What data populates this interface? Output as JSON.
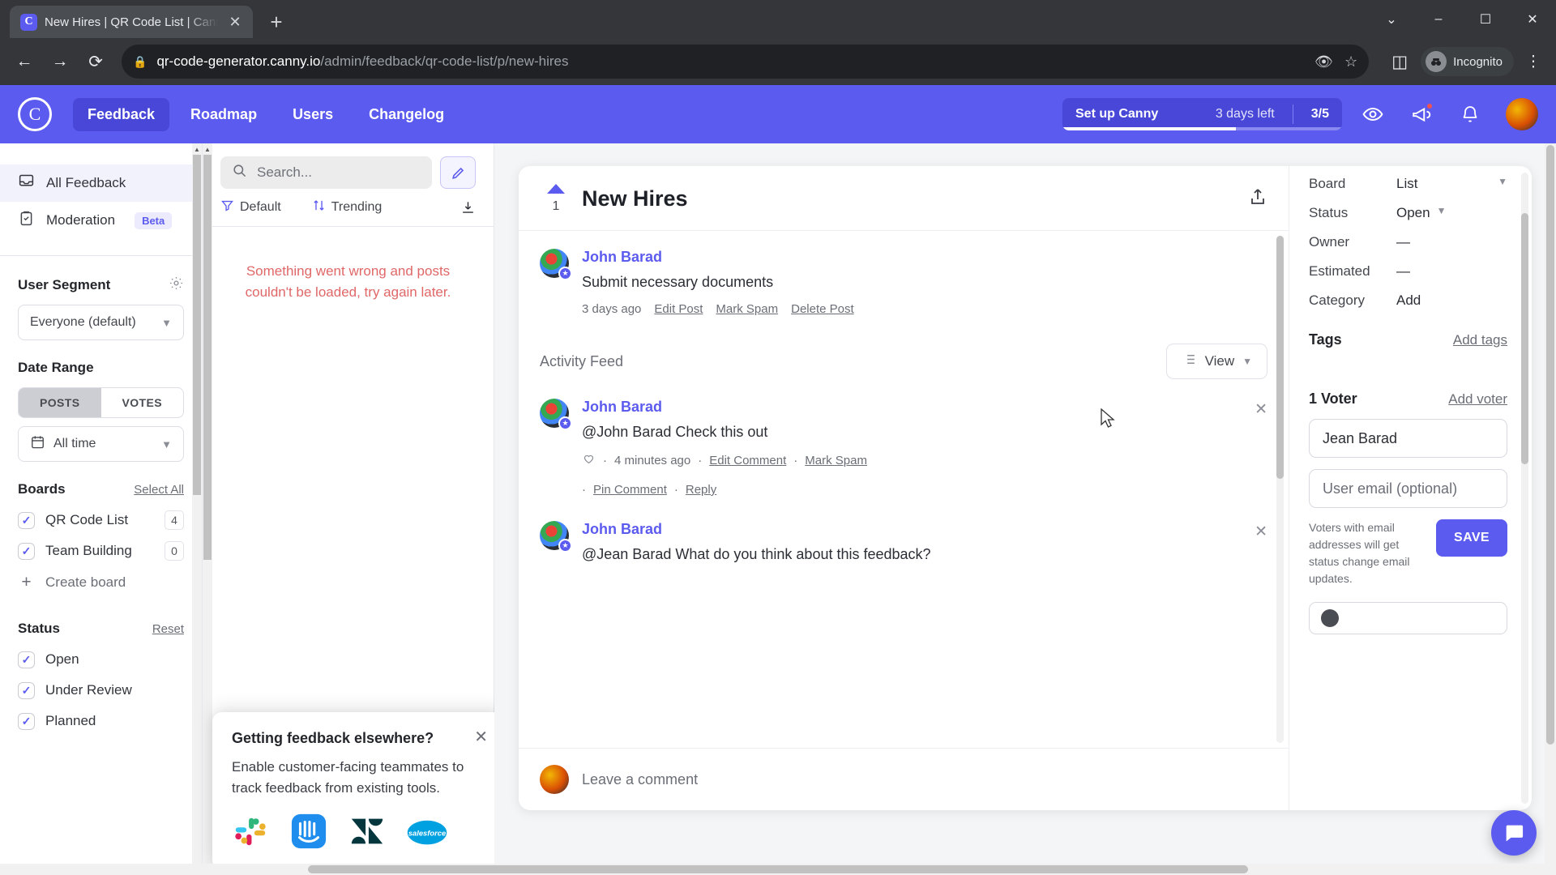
{
  "browser": {
    "tab": {
      "title": "New Hires | QR Code List | Canny",
      "favicon_icon": "canny-logo-icon",
      "close_icon": "close-icon"
    },
    "new_tab_icon": "plus-icon",
    "window_controls": [
      {
        "name": "chevron-down-icon",
        "glyph": "⌄"
      },
      {
        "name": "minimize-icon",
        "glyph": "–"
      },
      {
        "name": "maximize-icon",
        "glyph": "❐"
      },
      {
        "name": "close-icon",
        "glyph": "✕"
      }
    ],
    "nav": {
      "back_icon": "arrow-left-icon",
      "forward_icon": "arrow-right-icon",
      "reload_icon": "reload-icon"
    },
    "omnibox": {
      "lock_icon": "lock-icon",
      "url_host": "qr-code-generator.canny.io",
      "url_path": "/admin/feedback/qr-code-list/p/new-hires",
      "tracking_icon": "eye-off-icon",
      "bookmark_icon": "star-icon",
      "sidepanel_icon": "side-panel-icon"
    },
    "incognito_label": "Incognito",
    "menu_icon": "kebab-menu-icon"
  },
  "app_header": {
    "logo_icon": "canny-logo-icon",
    "nav_items": [
      {
        "label": "Feedback",
        "active": true
      },
      {
        "label": "Roadmap",
        "active": false
      },
      {
        "label": "Users",
        "active": false
      },
      {
        "label": "Changelog",
        "active": false
      }
    ],
    "setup_widget": {
      "label": "Set up Canny",
      "days_left": "3 days left",
      "count": "3/5",
      "progress_percent": 60
    },
    "icons": [
      {
        "name": "eye-icon",
        "glyph": "◉"
      },
      {
        "name": "megaphone-icon",
        "glyph": "📣",
        "dot": true
      },
      {
        "name": "bell-icon",
        "glyph": "🔔",
        "dot": false
      }
    ],
    "avatar_name": "user-avatar"
  },
  "sidebar": {
    "links": [
      {
        "label": "All Feedback",
        "icon": "inbox-icon",
        "active": true,
        "badge": ""
      },
      {
        "label": "Moderation",
        "icon": "clipboard-check-icon",
        "active": false,
        "badge": "Beta"
      }
    ],
    "user_segment": {
      "title": "User Segment",
      "gear_icon": "gear-icon",
      "selected": "Everyone (default)",
      "chevron_icon": "chevron-down-icon"
    },
    "date_range": {
      "title": "Date Range",
      "toggle": [
        {
          "label": "POSTS",
          "selected": true
        },
        {
          "label": "VOTES",
          "selected": false
        }
      ],
      "selected": "All time",
      "calendar_icon": "calendar-icon",
      "chevron_icon": "chevron-down-icon"
    },
    "boards": {
      "title": "Boards",
      "action_label": "Select All",
      "items": [
        {
          "label": "QR Code List",
          "checked": true,
          "count": "4"
        },
        {
          "label": "Team Building",
          "checked": true,
          "count": "0"
        }
      ],
      "create_label": "Create board",
      "create_icon": "plus-icon"
    },
    "status": {
      "title": "Status",
      "action_label": "Reset",
      "items": [
        {
          "label": "Open",
          "checked": true
        },
        {
          "label": "Under Review",
          "checked": true
        },
        {
          "label": "Planned",
          "checked": true
        }
      ]
    }
  },
  "list_column": {
    "search_placeholder": "Search...",
    "search_icon": "search-icon",
    "compose_icon": "pencil-icon",
    "tools": [
      {
        "label": "Default",
        "icon": "filter-icon"
      },
      {
        "label": "Trending",
        "icon": "sort-icon"
      }
    ],
    "download_icon": "download-icon",
    "error_message": "Something went wrong and posts couldn't be loaded, try again later.",
    "promo": {
      "title": "Getting feedback elsewhere?",
      "description": "Enable customer-facing teammates to track feedback from existing tools.",
      "close_icon": "close-icon",
      "logos": [
        "slack-logo",
        "intercom-logo",
        "zendesk-logo",
        "salesforce-logo"
      ]
    }
  },
  "post": {
    "vote_count": "1",
    "title": "New Hires",
    "share_icon": "share-icon",
    "author": "John Barad",
    "body": "Submit necessary documents",
    "meta": {
      "time": "3 days ago",
      "actions": [
        "Edit Post",
        "Mark Spam",
        "Delete Post"
      ]
    },
    "activity_feed_label": "Activity Feed",
    "view_button": {
      "label": "View",
      "icon": "list-icon",
      "chevron_icon": "chevron-down-icon"
    },
    "comments": [
      {
        "author": "John Barad",
        "text": "@John Barad Check this out",
        "heart_icon": "heart-icon",
        "time": "4 minutes ago",
        "actions": [
          "Edit Comment",
          "Mark Spam",
          "Pin Comment",
          "Reply"
        ],
        "close_icon": "close-icon"
      },
      {
        "author": "John Barad",
        "text": "@Jean Barad What do you think about this feedback?",
        "time": "",
        "actions": [],
        "close_icon": "close-icon"
      }
    ],
    "comment_placeholder": "Leave a comment"
  },
  "detail_panel": {
    "rows": [
      {
        "label": "Board",
        "value": "List",
        "chevron": true
      },
      {
        "label": "Status",
        "value": "Open",
        "chevron": true
      },
      {
        "label": "Owner",
        "value": "—",
        "chevron": false
      },
      {
        "label": "Estimated",
        "value": "—",
        "chevron": false
      },
      {
        "label": "Category",
        "value": "Add",
        "chevron": false
      }
    ],
    "tags": {
      "title": "Tags",
      "action_label": "Add tags"
    },
    "voters": {
      "title": "1 Voter",
      "action_label": "Add voter",
      "name_value": "Jean Barad",
      "email_placeholder": "User email (optional)",
      "note": "Voters with email addresses will get status change email updates.",
      "save_label": "SAVE"
    }
  },
  "chat_fab_icon": "chat-bubble-icon",
  "colors": {
    "brand_purple": "#5c5bef",
    "error_red": "#e06767",
    "chrome_dark": "#35363a"
  }
}
